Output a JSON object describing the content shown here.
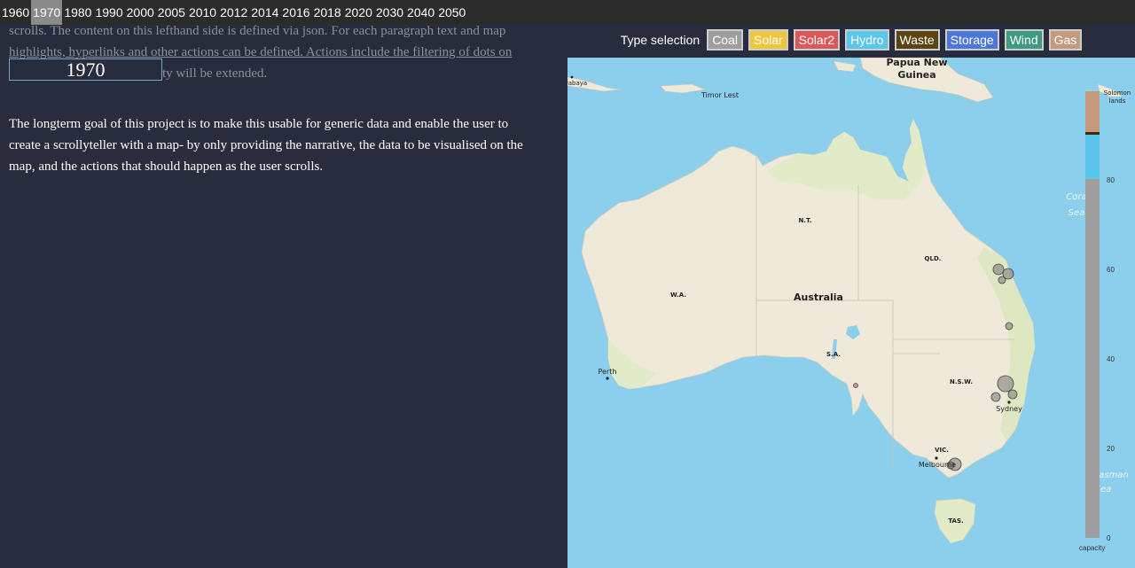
{
  "years": {
    "items": [
      "1960",
      "1970",
      "1980",
      "1990",
      "2000",
      "2005",
      "2010",
      "2012",
      "2014",
      "2016",
      "2018",
      "2020",
      "2030",
      "2040",
      "2050"
    ],
    "active": "1970"
  },
  "left": {
    "faded_line1": "scrolls. The content on this lefthand side is defined via json. For each paragraph text and map",
    "faded_line2_link": "highlights, hyperlinks and other actions can be defined. Actions include the filtering of dots on",
    "faded_line3_tail": "ty will be extended.",
    "year_display": "1970",
    "paragraph": "The longterm goal of this project is to make this usable for generic data and enable the user to create a scrollyteller with a map- by only providing the narrative, the data to be visualised on the map, and the actions that should happen as the user scrolls."
  },
  "type_selection": {
    "label": "Type selection",
    "types": [
      {
        "label": "Coal",
        "color": "#9e9e9e"
      },
      {
        "label": "Solar",
        "color": "#f0c63c"
      },
      {
        "label": "Solar2",
        "color": "#d9585a"
      },
      {
        "label": "Hydro",
        "color": "#5bc6ec"
      },
      {
        "label": "Waste",
        "color": "#5a4512"
      },
      {
        "label": "Storage",
        "color": "#4f76d9"
      },
      {
        "label": "Wind",
        "color": "#3f9a82"
      },
      {
        "label": "Gas",
        "color": "#c49a7e"
      }
    ]
  },
  "map": {
    "places": {
      "papua": "Papua New",
      "guinea": "Guinea",
      "timor": "Timor Lest",
      "surabaya": "rabaya",
      "solomon1": "Solomon",
      "solomon2": "lands",
      "coral1": "Cora",
      "coral2": "Sea",
      "tasman1": "asman",
      "tasman2": "Sea",
      "australia": "Australia",
      "nt": "N.T.",
      "wa": "W.A.",
      "qld": "QLD.",
      "sa": "S.A.",
      "nsw": "N.S.W.",
      "vic": "VIC.",
      "tas": "TAS.",
      "perth": "Perth",
      "sydney": "Sydney",
      "melbourne": "Melbourne"
    }
  },
  "legend": {
    "ticks": [
      "80",
      "60",
      "40",
      "20",
      "0"
    ],
    "caption": "capacity",
    "colors": {
      "gas": "#c49a7e",
      "waste": "#3a2c10",
      "hydro": "#5bc6ec",
      "coal": "#9e9e9e"
    }
  }
}
